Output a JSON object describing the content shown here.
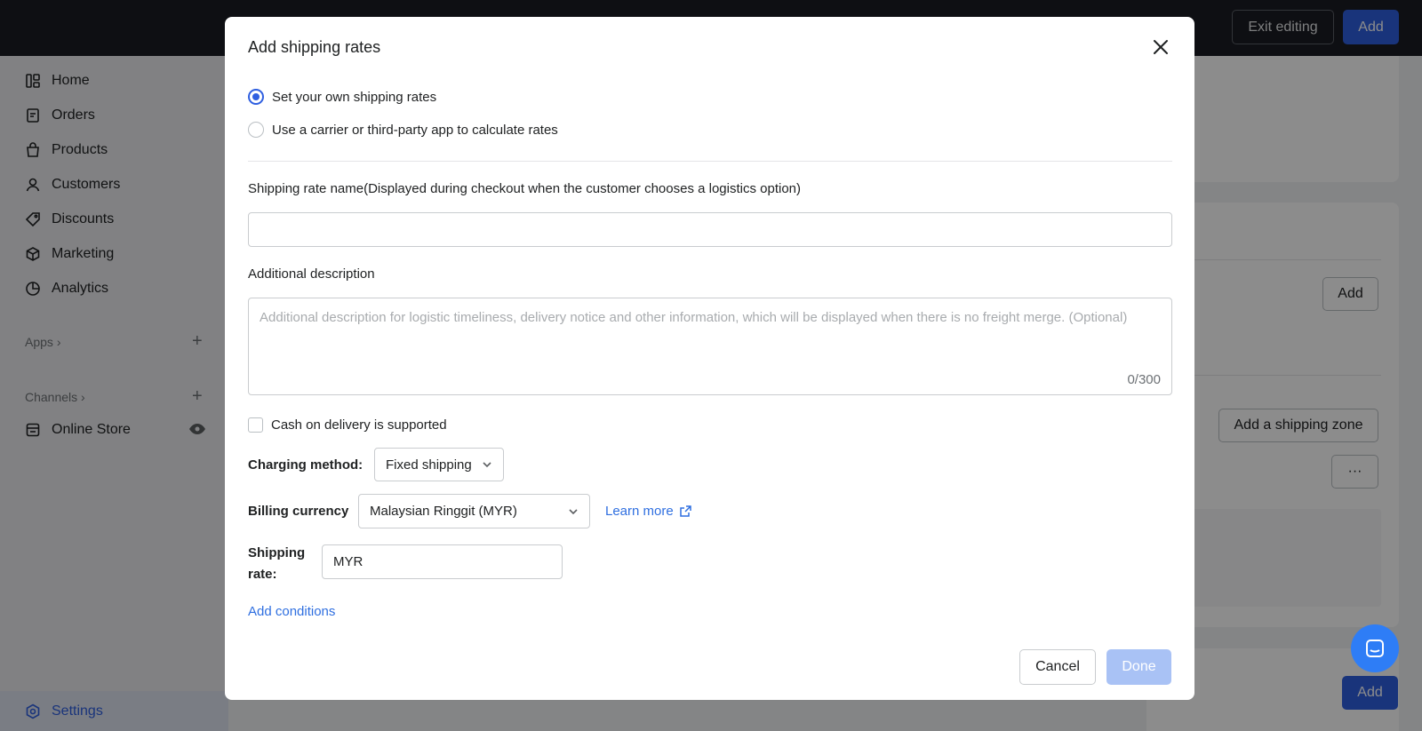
{
  "topbar": {
    "exit_label": "Exit editing",
    "add_label": "Add"
  },
  "sidebar": {
    "items": [
      {
        "label": "Home",
        "icon": "home-icon"
      },
      {
        "label": "Orders",
        "icon": "orders-icon"
      },
      {
        "label": "Products",
        "icon": "products-icon"
      },
      {
        "label": "Customers",
        "icon": "customers-icon"
      },
      {
        "label": "Discounts",
        "icon": "discounts-icon"
      },
      {
        "label": "Marketing",
        "icon": "marketing-icon"
      },
      {
        "label": "Analytics",
        "icon": "analytics-icon"
      }
    ],
    "apps_label": "Apps",
    "channels_label": "Channels",
    "online_store_label": "Online Store",
    "settings_label": "Settings"
  },
  "background": {
    "add_label": "Add",
    "add_zone_label": "Add a shipping zone",
    "more_label": "···",
    "bottom_add_label": "Add"
  },
  "modal": {
    "title": "Add shipping rates",
    "radio_own": "Set your own shipping rates",
    "radio_carrier": "Use a carrier or third-party app to calculate rates",
    "rate_name_label": "Shipping rate name",
    "rate_name_hint": "(Displayed during checkout when the customer chooses a logistics option)",
    "rate_name_value": "",
    "description_label": "Additional description",
    "description_placeholder": "Additional description for logistic timeliness, delivery notice and other information, which will be displayed when there is no freight merge. (Optional)",
    "description_counter": "0/300",
    "cod_label": "Cash on delivery is supported",
    "charging_label": "Charging method:",
    "charging_value": "Fixed shipping",
    "currency_label": "Billing currency",
    "currency_value": "Malaysian Ringgit (MYR)",
    "learn_more": "Learn more",
    "shipping_rate_label_1": "Shipping",
    "shipping_rate_label_2": "rate:",
    "shipping_rate_prefix": "MYR",
    "add_conditions": "Add conditions",
    "cancel_label": "Cancel",
    "done_label": "Done"
  },
  "colors": {
    "primary": "#2f5fe0",
    "link": "#2f6fe0",
    "done_disabled": "#a9c2f5"
  }
}
